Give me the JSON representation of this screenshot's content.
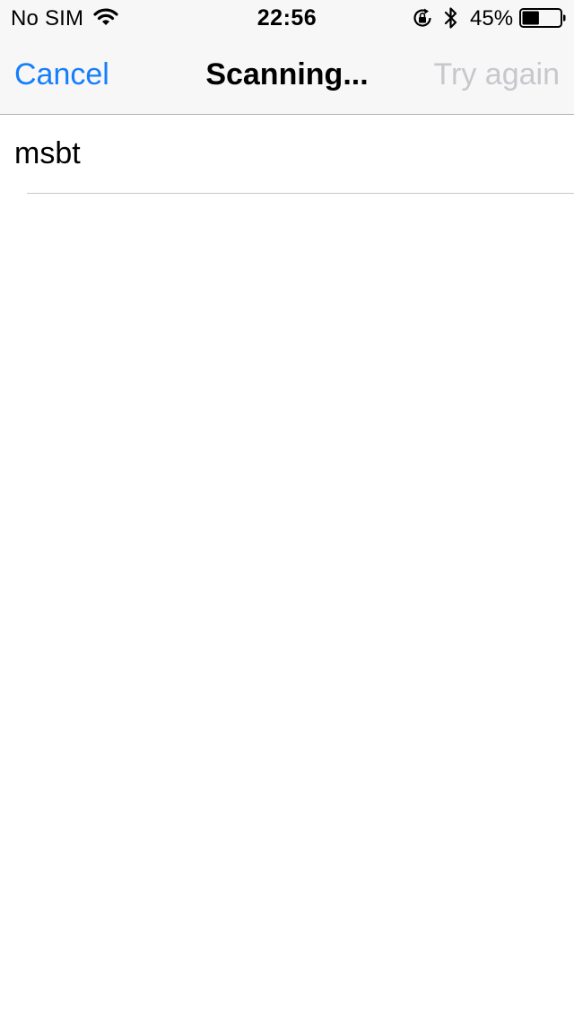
{
  "status_bar": {
    "carrier": "No SIM",
    "time": "22:56",
    "battery_percent": "45%",
    "battery_level": 0.45,
    "icons": [
      "wifi-icon",
      "rotation-lock-icon",
      "bluetooth-icon",
      "battery-icon"
    ]
  },
  "nav": {
    "cancel_label": "Cancel",
    "title": "Scanning...",
    "try_again_label": "Try again"
  },
  "devices": [
    {
      "name": "msbt"
    }
  ],
  "colors": {
    "accent": "#157efb",
    "disabled": "#c7c7cd",
    "header_bg": "#f7f7f7",
    "separator": "#c8c7cc"
  }
}
